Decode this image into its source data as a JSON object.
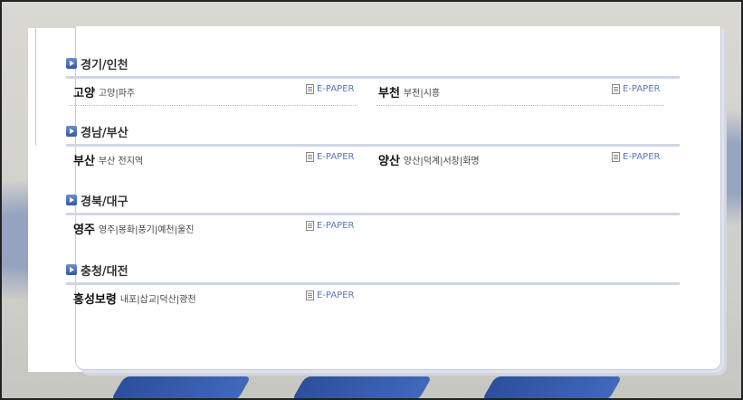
{
  "sections": [
    {
      "title": "경기/인천",
      "entries": [
        {
          "city": "고양",
          "areas": "고양|파주",
          "epaper": "E-PAPER"
        },
        {
          "city": "부천",
          "areas": "부천|시흥",
          "epaper": "E-PAPER"
        }
      ]
    },
    {
      "title": "경남/부산",
      "entries": [
        {
          "city": "부산",
          "areas": "부산 전지역",
          "epaper": "E-PAPER"
        },
        {
          "city": "양산",
          "areas": "양산|덕계|서창|화명",
          "epaper": "E-PAPER"
        }
      ]
    },
    {
      "title": "경북/대구",
      "entries": [
        {
          "city": "영주",
          "areas": "영주|봉화|풍기|예천|울진",
          "epaper": "E-PAPER"
        }
      ]
    },
    {
      "title": "충청/대전",
      "entries": [
        {
          "city": "홍성보령",
          "areas": "내포|삽교|덕산|광천",
          "epaper": "E-PAPER"
        }
      ]
    }
  ],
  "colors": {
    "accent": "#3558a8",
    "rule": "#cfd6e6",
    "link": "#5a7ab4"
  }
}
